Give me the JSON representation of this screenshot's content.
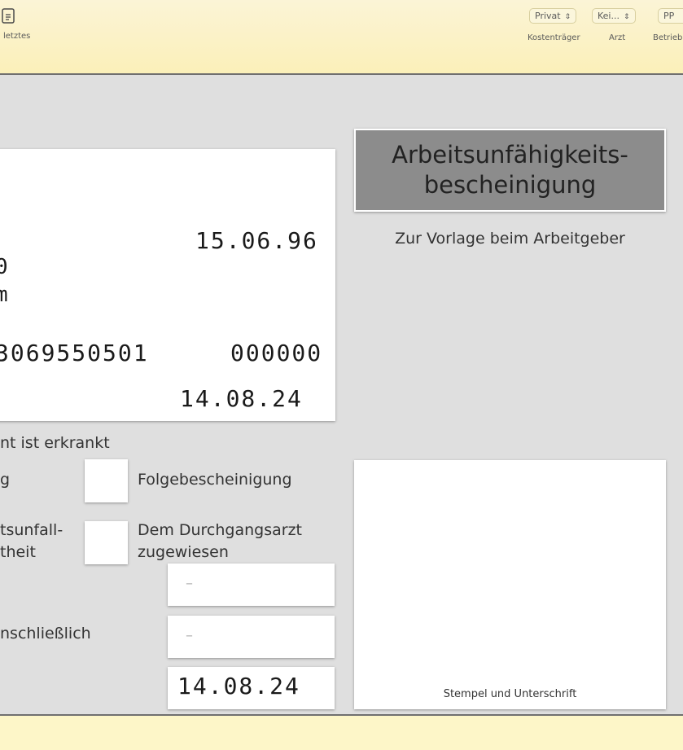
{
  "toolbar": {
    "last_label": "letztes",
    "payer_value": "Privat",
    "payer_label": "Kostenträger",
    "doctor_value": "Kei...",
    "doctor_label": "Arzt",
    "practice_value": "PP",
    "practice_label": "Betrieb",
    "chevron_glyph": "⇕"
  },
  "patient_card": {
    "date_top": "15.06.96",
    "line_a": "0",
    "line_b": "m",
    "number_left": "3069550501",
    "number_right": "000000",
    "date_bottom": "14.08.24"
  },
  "form": {
    "title_line1": "Arbeitsunfähigkeits-",
    "title_line2": "bescheinigung",
    "subtitle": "Zur Vorlage beim Arbeitgeber",
    "status_text": "nt ist erkrankt",
    "first_label": "g",
    "follow_label": "Folgebescheinigung",
    "accident_line1": "tsunfall-",
    "accident_line2": "theit",
    "durchgang_line1": "Dem Durchgangsarzt",
    "durchgang_line2": "zugewiesen",
    "until_label": "nschließlich",
    "field1_value": "–",
    "field2_value": "–",
    "field3_value": "14.08.24",
    "stamp_caption": "Stempel und Unterschrift"
  }
}
